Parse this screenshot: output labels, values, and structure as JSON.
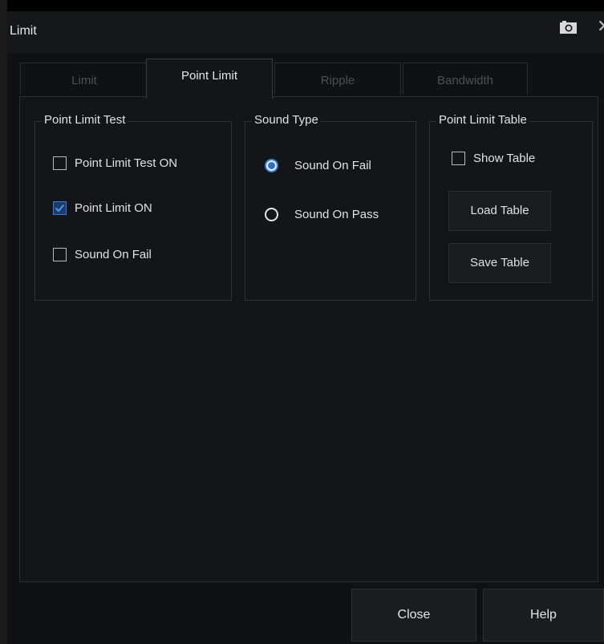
{
  "window": {
    "title": "Limit"
  },
  "tabs": [
    {
      "label": "Limit",
      "active": false
    },
    {
      "label": "Point Limit",
      "active": true
    },
    {
      "label": "Ripple",
      "active": false
    },
    {
      "label": "Bandwidth",
      "active": false
    }
  ],
  "point_limit_test": {
    "title": "Point Limit Test",
    "items": [
      {
        "label": "Point Limit Test ON",
        "checked": false
      },
      {
        "label": "Point Limit ON",
        "checked": true
      },
      {
        "label": "Sound On Fail",
        "checked": false
      }
    ]
  },
  "sound_type": {
    "title": "Sound Type",
    "options": [
      {
        "label": "Sound On Fail",
        "selected": true
      },
      {
        "label": "Sound On Pass",
        "selected": false
      }
    ]
  },
  "point_limit_table": {
    "title": "Point Limit Table",
    "show_table": {
      "label": "Show Table",
      "checked": false
    },
    "load_label": "Load Table",
    "save_label": "Save Table"
  },
  "footer": {
    "close_label": "Close",
    "help_label": "Help"
  },
  "colors": {
    "accent": "#3b7bd6",
    "background": "#141518"
  }
}
